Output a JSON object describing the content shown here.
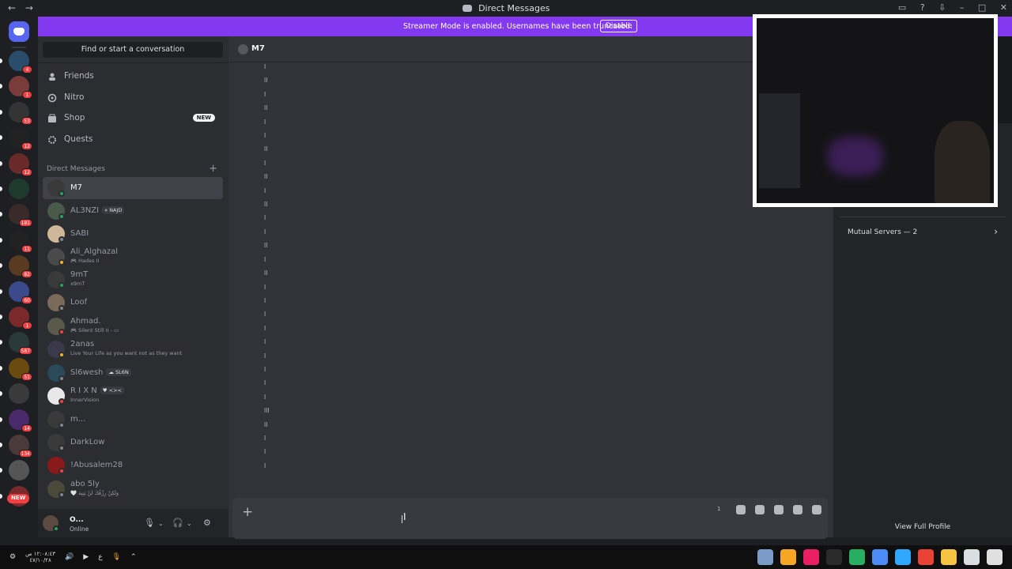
{
  "window": {
    "title": "Direct Messages",
    "back_glyph": "←",
    "forward_glyph": "→",
    "controls": [
      "▭",
      "?",
      "⇩",
      "–",
      "□",
      "✕"
    ]
  },
  "banner": {
    "message": "Streamer Mode is enabled. Usernames have been truncated.",
    "button": "Disable"
  },
  "sidebar": {
    "search_placeholder": "Find or start a conversation",
    "nav": [
      {
        "label": "Friends",
        "icon": "friends-icon"
      },
      {
        "label": "Nitro",
        "icon": "nitro-icon"
      },
      {
        "label": "Shop",
        "icon": "shop-icon",
        "badge": "NEW"
      },
      {
        "label": "Quests",
        "icon": "quests-icon"
      }
    ],
    "dm_header": "Direct Messages",
    "dm_add": "+",
    "dms": [
      {
        "name": "M7",
        "status": "online",
        "active": true
      },
      {
        "name": "AL3NZI",
        "tag": "⋄ NAJD",
        "status": "online"
      },
      {
        "name": "SABI",
        "status": "offline"
      },
      {
        "name": "Ali_Alghazal",
        "sub": "🎮 Hades II",
        "status": "idle"
      },
      {
        "name": "9mT",
        "sub": "x9mT",
        "status": "online"
      },
      {
        "name": "Loof",
        "status": "offline"
      },
      {
        "name": "Ahmad.",
        "sub": "🎮 Silent Still II - ▭",
        "status": "dnd"
      },
      {
        "name": "2anas",
        "sub": "Live Your Life as you want not as they want",
        "status": "idle"
      },
      {
        "name": "Sl6wesh",
        "tag": "☁ SL6N",
        "status": "offline"
      },
      {
        "name": "R I X N",
        "tag": "♥ <><",
        "sub": "InnerVision",
        "status": "dnd"
      },
      {
        "name": "m...",
        "status": "offline"
      },
      {
        "name": "DarkLow",
        "status": "offline"
      },
      {
        "name": "!Abusalem28",
        "status": "dnd"
      },
      {
        "name": "abo 5ly",
        "sub": "🤍 وَلَكِنْ رِزْقُكَ لَنْ يَتِيهَ",
        "status": "offline"
      }
    ],
    "user": {
      "name": "O...",
      "status": "Online"
    }
  },
  "guilds": {
    "badges": [
      "4",
      "1",
      "53",
      "12",
      "12",
      "",
      "181",
      "11",
      "82",
      "60",
      "1",
      "587",
      "51",
      "",
      "14",
      "134",
      "",
      ""
    ],
    "new_label": "NEW"
  },
  "chat": {
    "recipient": "M7",
    "message_glyphs": [
      "ا",
      "اا",
      "ا",
      "اا",
      "ا",
      "ا",
      "اا",
      "ا",
      "اا",
      "ا",
      "اا",
      "ا",
      "ا",
      "اا",
      "ا",
      "اا",
      "ا",
      "ا",
      "ا",
      "ا",
      "ا",
      "ا",
      "ا",
      "ا",
      "ا",
      "ااا",
      "اا",
      "ا",
      "ا",
      "ا"
    ],
    "composer_plus": "+",
    "char_count": "1"
  },
  "profile": {
    "mutual_servers": "Mutual Servers — 2",
    "view_full_profile": "View Full Profile"
  },
  "taskbar": {
    "clock_time": "١٢:٠٨:٤٣ ص",
    "clock_date": "٤٧/١٠/٢٨",
    "lang": "ع",
    "apps": [
      "#7a9cc6",
      "#f5a623",
      "#e91e63",
      "#2b2b2b",
      "#27ae60",
      "#4c8bf5",
      "#31a8ff",
      "#ea4335",
      "#f6c343",
      "#dbdee1",
      "#e0e0e0"
    ]
  }
}
